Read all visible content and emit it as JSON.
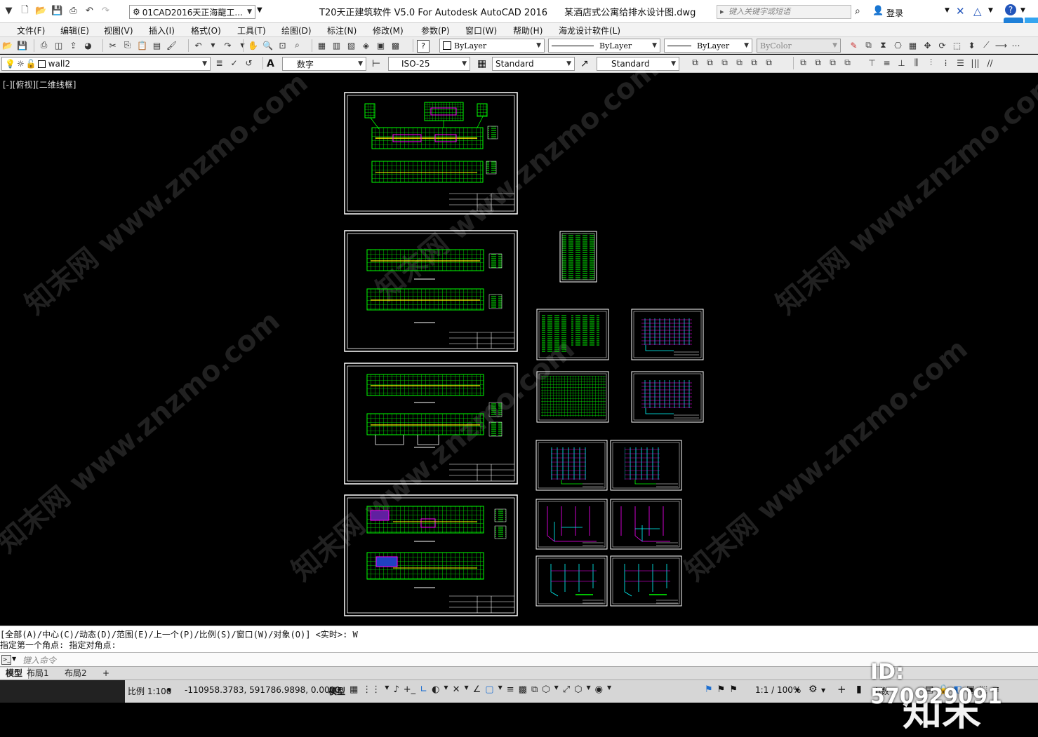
{
  "titlebar": {
    "doc_combo": "01CAD2016天正海龍工...",
    "title": "T20天正建筑软件 V5.0 For Autodesk AutoCAD 2016",
    "filename": "某酒店式公寓给排水设计图.dwg",
    "search_placeholder": "键入关键字或短语",
    "login": "登录"
  },
  "menu": [
    "文件(F)",
    "编辑(E)",
    "视图(V)",
    "插入(I)",
    "格式(O)",
    "工具(T)",
    "绘图(D)",
    "标注(N)",
    "修改(M)",
    "参数(P)",
    "窗口(W)",
    "帮助(H)",
    "海龙设计软件(L)"
  ],
  "toolbar1": {
    "color": "ByLayer",
    "linetype": "ByLayer",
    "lineweight": "ByLayer",
    "plotstyle": "ByColor"
  },
  "toolbar2": {
    "layer": "wall2",
    "text_style": "数字",
    "dim_style": "ISO-25",
    "table_style": "Standard",
    "mleader_style": "Standard"
  },
  "viewport_label": "[-][俯视][二维线框]",
  "command": {
    "line1": "[全部(A)/中心(C)/动态(D)/范围(E)/上一个(P)/比例(S)/窗口(W)/对象(O)] <实时>: W",
    "line2": "指定第一个角点: 指定对角点:",
    "placeholder": "键入命令"
  },
  "tabs": [
    "模型",
    "布局1",
    "布局2",
    "+"
  ],
  "status": {
    "scale": "比例 1:100",
    "coords": "-110958.3783, 591786.9898, 0.0000",
    "model": "模型",
    "anno_scale": "1:1 / 100%",
    "units": "小数"
  },
  "watermark": "知末网 www.znzmo.com",
  "brand": "知末",
  "id_tag": "ID: 570929091",
  "colors": {
    "sheet_border": "#ffffff",
    "plan_green": "#00ff00",
    "pipe_cyan": "#00ffff",
    "accent_magenta": "#ff00ff"
  }
}
